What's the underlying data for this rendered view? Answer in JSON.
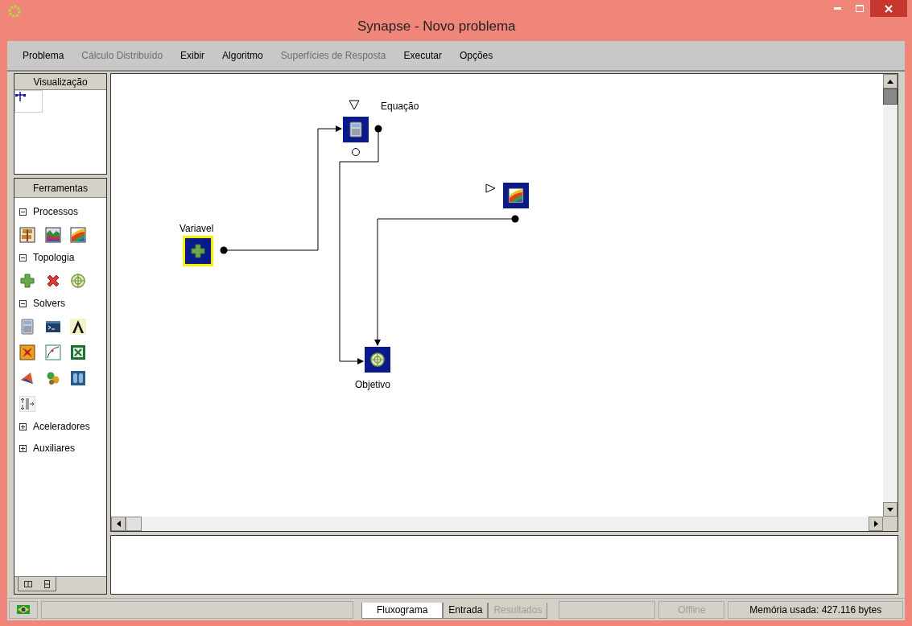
{
  "window": {
    "title": "Synapse - Novo problema"
  },
  "menu": [
    {
      "label": "Problema",
      "disabled": false
    },
    {
      "label": "Cálculo Distribuído",
      "disabled": true
    },
    {
      "label": "Exibir",
      "disabled": false
    },
    {
      "label": "Algoritmo",
      "disabled": false
    },
    {
      "label": "Superfícies de Resposta",
      "disabled": true
    },
    {
      "label": "Executar",
      "disabled": false
    },
    {
      "label": "Opções",
      "disabled": false
    }
  ],
  "visualization": {
    "title": "Visualização"
  },
  "tools": {
    "title": "Ferramentas",
    "sections": [
      {
        "label": "Processos",
        "expanded": true,
        "tools": [
          {
            "kind": "signpost"
          },
          {
            "kind": "surface"
          },
          {
            "kind": "contour"
          }
        ]
      },
      {
        "label": "Topologia",
        "expanded": true,
        "tools": [
          {
            "kind": "plus"
          },
          {
            "kind": "cross"
          },
          {
            "kind": "target"
          }
        ]
      },
      {
        "label": "Solvers",
        "expanded": true,
        "tools": [
          {
            "kind": "calculator"
          },
          {
            "kind": "terminal"
          },
          {
            "kind": "lambda"
          },
          {
            "kind": "burst"
          },
          {
            "kind": "curve"
          },
          {
            "kind": "sheet"
          },
          {
            "kind": "cone"
          },
          {
            "kind": "molecule"
          },
          {
            "kind": "brackets"
          },
          {
            "kind": "arrows"
          }
        ]
      },
      {
        "label": "Aceleradores",
        "expanded": false
      },
      {
        "label": "Auxiliares",
        "expanded": false
      }
    ]
  },
  "diagram": {
    "nodes": [
      {
        "kind": "plus",
        "label": "Variavel",
        "selected": true
      },
      {
        "kind": "calculator",
        "label": "Equação",
        "selected": false
      },
      {
        "kind": "contour",
        "selected": false
      },
      {
        "kind": "target",
        "label": "Objetivo",
        "selected": false
      }
    ]
  },
  "view_tabs": [
    {
      "label": "Fluxograma",
      "selected": true,
      "disabled": false
    },
    {
      "label": "Entrada",
      "selected": false,
      "disabled": false
    },
    {
      "label": "Resultados",
      "selected": false,
      "disabled": true
    }
  ],
  "status_bar": {
    "connection": {
      "label": "Offline",
      "disabled": true
    },
    "memory": "Memória usada: 427.116 bytes"
  }
}
